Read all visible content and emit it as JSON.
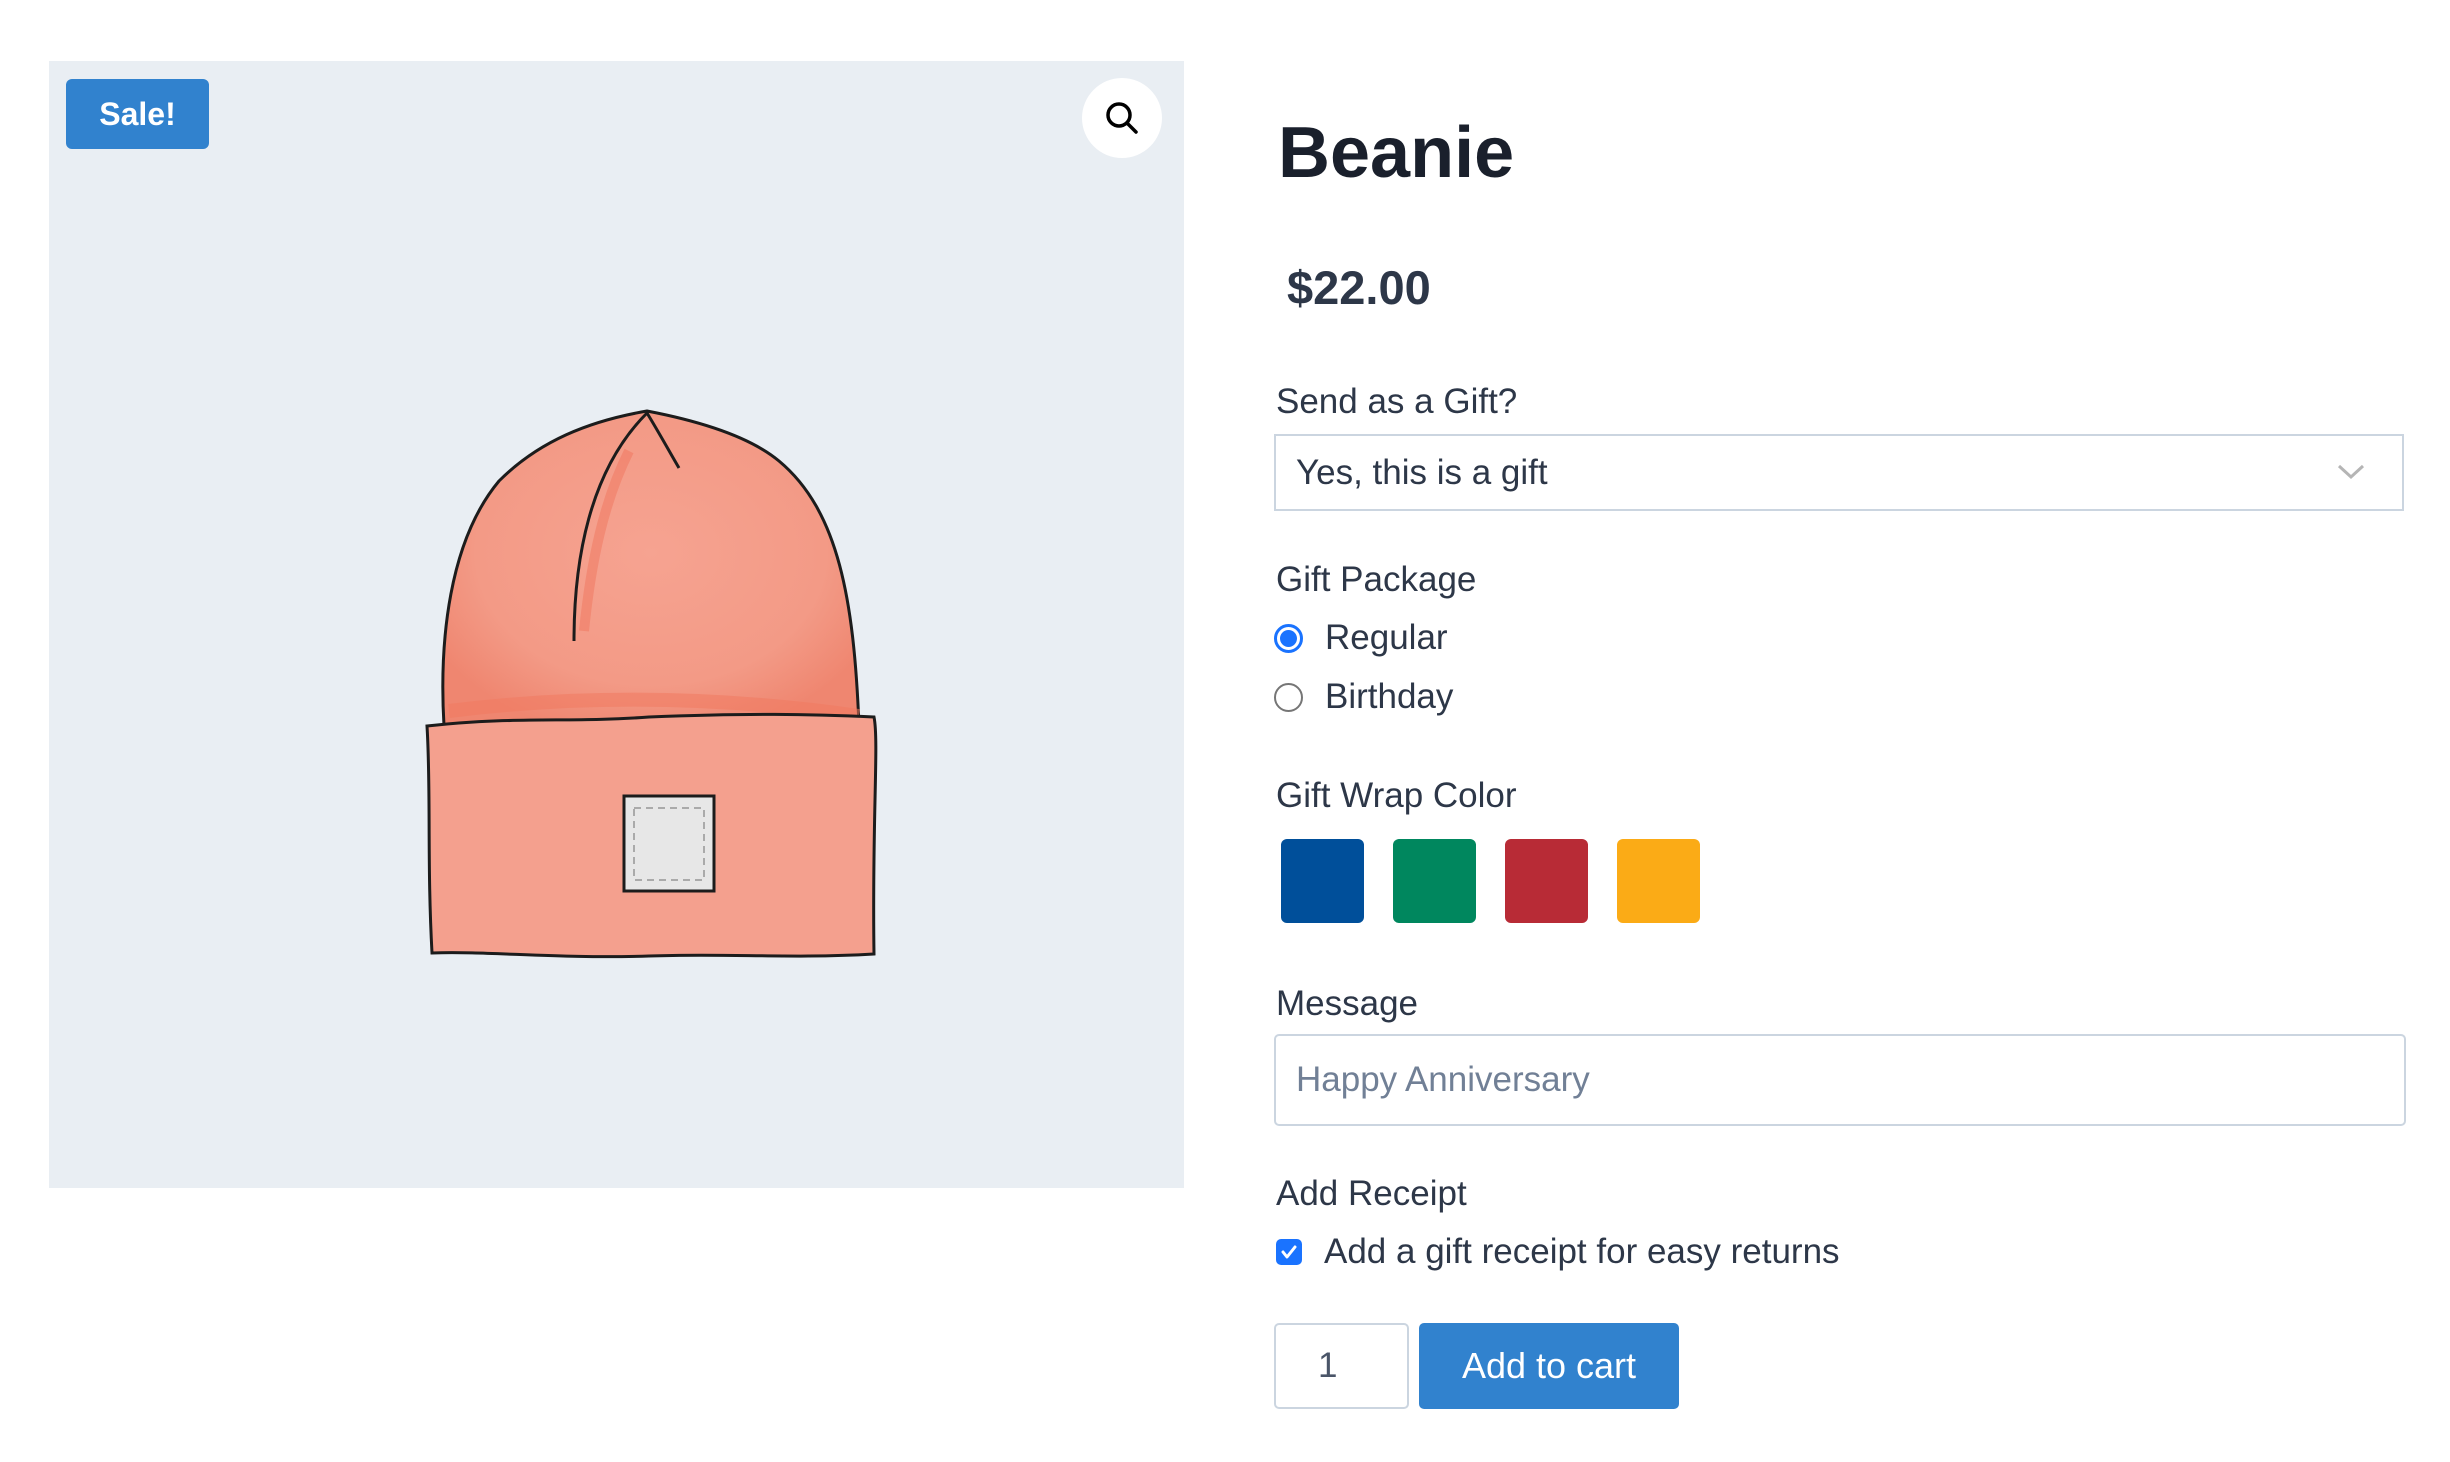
{
  "gallery": {
    "sale_badge": "Sale!",
    "zoom_icon": "magnifier-icon",
    "image_alt": "Beanie"
  },
  "product": {
    "title": "Beanie",
    "price": "$22.00"
  },
  "gift": {
    "label": "Send as a Gift?",
    "selected": "Yes, this is a gift",
    "chevron_icon": "chevron-down-icon"
  },
  "package": {
    "label": "Gift Package",
    "options": [
      {
        "label": "Regular",
        "checked": true
      },
      {
        "label": "Birthday",
        "checked": false
      }
    ]
  },
  "wrap": {
    "label": "Gift Wrap Color",
    "colors": [
      "#004f9a",
      "#00875e",
      "#b82b36",
      "#fbab16"
    ]
  },
  "message": {
    "label": "Message",
    "value": "",
    "placeholder": "Happy Anniversary"
  },
  "receipt": {
    "label": "Add Receipt",
    "checkbox_label": "Add a gift receipt for easy returns",
    "checked": true
  },
  "cart": {
    "quantity": "1",
    "button_label": "Add to cart"
  },
  "colors": {
    "accent": "#3182ce",
    "control_blue": "#1a73ff",
    "gallery_bg": "#e9eef3",
    "text_dark": "#1a202c",
    "text": "#2d3748",
    "border": "#cbd5e0"
  }
}
